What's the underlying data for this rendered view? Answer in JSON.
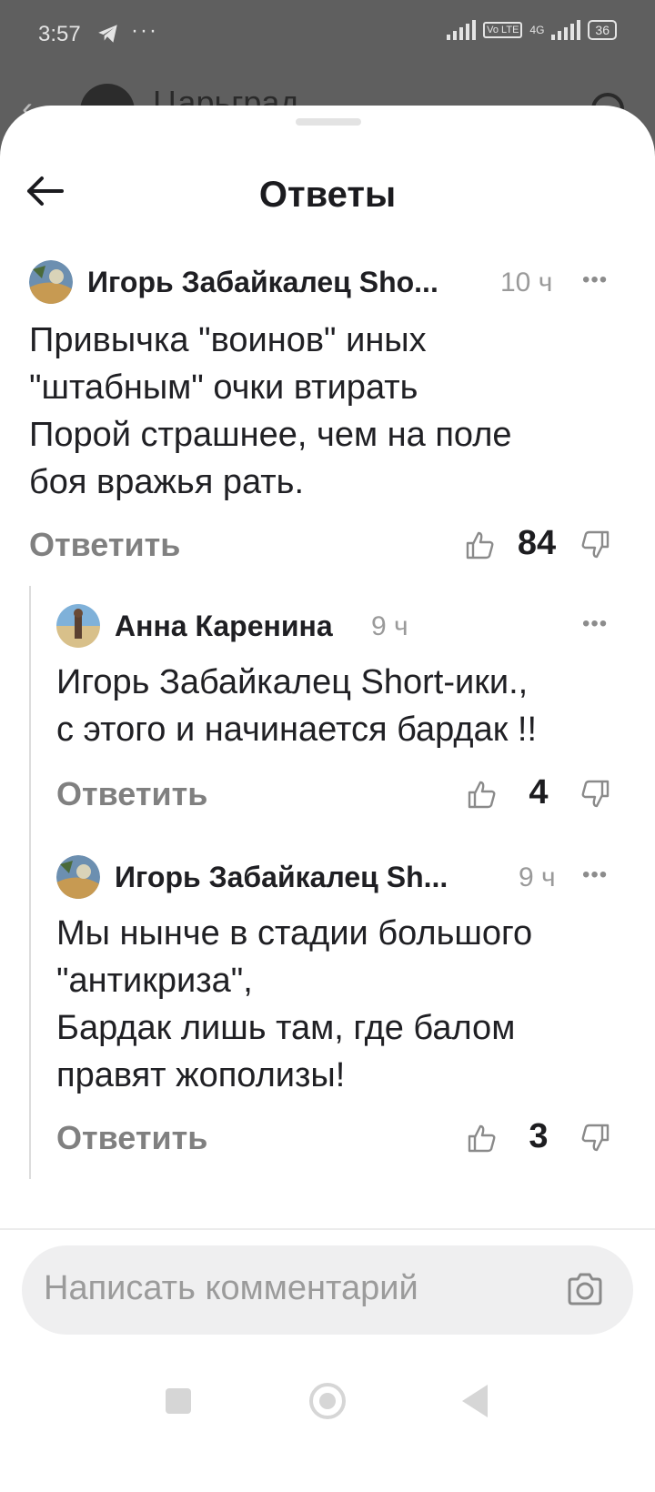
{
  "status": {
    "time": "3:57",
    "dots": "···",
    "volte": "Vo LTE",
    "network": "4G",
    "battery": "36"
  },
  "background": {
    "channel_title": "Царьград"
  },
  "sheet": {
    "title": "Ответы"
  },
  "comments": [
    {
      "author": "Игорь Забайкалец  Sho...",
      "time": "10 ч",
      "text": "Привычка \"воинов\" иных\n\"штабным\" очки втирать\nПорой страшнее, чем на поле\nбоя вражья рать.",
      "reply": "Ответить",
      "likes": "84"
    },
    {
      "author": "Анна Каренина",
      "time": "9 ч",
      "text": "Игорь Забайкалец  Short-ики.,\nс этого и начинается бардак !!",
      "reply": "Ответить",
      "likes": "4"
    },
    {
      "author": "Игорь Забайкалец  Sh...",
      "time": "9 ч",
      "text": "Мы нынче в стадии большого\n\"антикриза\",\nБардак лишь там, где балом\nправят жополизы!",
      "reply": "Ответить",
      "likes": "3"
    }
  ],
  "composer": {
    "placeholder": "Написать комментарий"
  },
  "colors": {
    "text": "#1f1f23",
    "muted": "#9a9a9a",
    "composer_bg": "#efeff0",
    "backdrop": "#5f5f5f"
  }
}
